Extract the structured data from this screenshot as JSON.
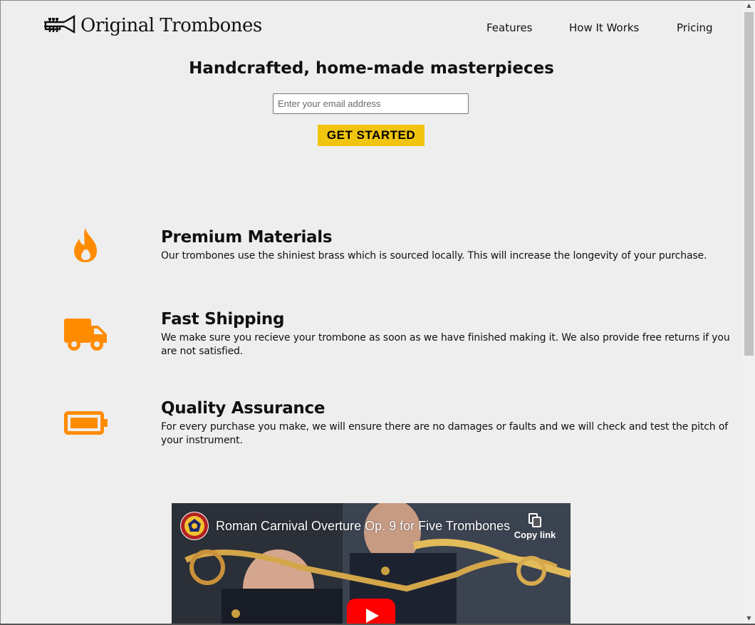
{
  "header": {
    "logo_text": "Original Trombones",
    "nav": [
      {
        "label": "Features"
      },
      {
        "label": "How It Works"
      },
      {
        "label": "Pricing"
      }
    ]
  },
  "hero": {
    "title": "Handcrafted, home-made masterpieces",
    "email_placeholder": "Enter your email address",
    "email_value": "",
    "cta_label": "GET STARTED"
  },
  "features": [
    {
      "icon": "fire-icon",
      "title": "Premium Materials",
      "description": "Our trombones use the shiniest brass which is sourced locally. This will increase the longevity of your purchase."
    },
    {
      "icon": "truck-icon",
      "title": "Fast Shipping",
      "description": "We make sure you recieve your trombone as soon as we have finished making it. We also provide free returns if you are not satisfied."
    },
    {
      "icon": "battery-icon",
      "title": "Quality Assurance",
      "description": "For every purchase you make, we will ensure there are no damages or faults and we will check and test the pitch of your instrument."
    }
  ],
  "video": {
    "title": "Roman Carnival Overture Op. 9 for Five Trombones",
    "copy_link_label": "Copy link"
  },
  "colors": {
    "background": "#eeeeee",
    "accent": "#f1c40f",
    "icon_orange": "#ff8c00",
    "youtube_red": "#ff0000"
  }
}
